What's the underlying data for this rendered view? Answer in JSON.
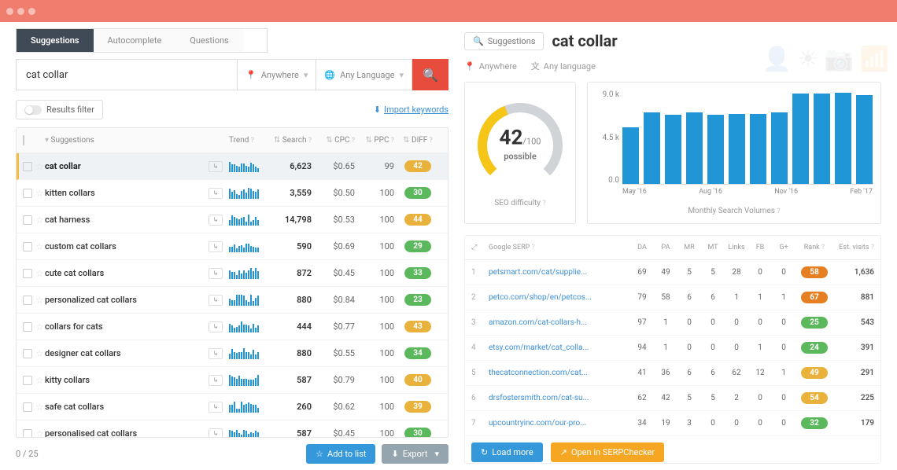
{
  "tabs": {
    "t0": "Suggestions",
    "t1": "Autocomplete",
    "t2": "Questions"
  },
  "query": "cat collar",
  "where_label": "Anywhere",
  "lang_label": "Any Language",
  "filter_label": "Results filter",
  "import_label": "Import keywords",
  "th": {
    "sug": "Suggestions",
    "trend": "Trend",
    "search": "Search",
    "cpc": "CPC",
    "ppc": "PPC",
    "diff": "DIFF"
  },
  "rows": [
    {
      "kw": "cat collar",
      "search": "6,623",
      "cpc": "$0.65",
      "ppc": "99",
      "diff": "42",
      "cls": "y",
      "active": true
    },
    {
      "kw": "kitten collars",
      "search": "3,559",
      "cpc": "$0.50",
      "ppc": "100",
      "diff": "30",
      "cls": "g"
    },
    {
      "kw": "cat harness",
      "search": "14,798",
      "cpc": "$0.53",
      "ppc": "100",
      "diff": "44",
      "cls": "y"
    },
    {
      "kw": "custom cat collars",
      "search": "590",
      "cpc": "$0.69",
      "ppc": "100",
      "diff": "29",
      "cls": "g"
    },
    {
      "kw": "cute cat collars",
      "search": "872",
      "cpc": "$0.45",
      "ppc": "100",
      "diff": "33",
      "cls": "g"
    },
    {
      "kw": "personalized cat collars",
      "search": "880",
      "cpc": "$0.84",
      "ppc": "100",
      "diff": "23",
      "cls": "g"
    },
    {
      "kw": "collars for cats",
      "search": "444",
      "cpc": "$0.77",
      "ppc": "100",
      "diff": "43",
      "cls": "y"
    },
    {
      "kw": "designer cat collars",
      "search": "880",
      "cpc": "$0.55",
      "ppc": "100",
      "diff": "34",
      "cls": "g"
    },
    {
      "kw": "kitty collars",
      "search": "587",
      "cpc": "$0.79",
      "ppc": "100",
      "diff": "40",
      "cls": "y"
    },
    {
      "kw": "safe cat collars",
      "search": "260",
      "cpc": "$0.62",
      "ppc": "100",
      "diff": "39",
      "cls": "y"
    },
    {
      "kw": "personalised cat collars",
      "search": "587",
      "cpc": "$0.45",
      "ppc": "100",
      "diff": "30",
      "cls": "g"
    }
  ],
  "pager": "0 / 25",
  "add_label": "Add to list",
  "export_label": "Export",
  "bc_btn": "Suggestions",
  "bc_title": "cat collar",
  "loc_where": "Anywhere",
  "loc_lang": "Any language",
  "gauge": {
    "n": "42",
    "d": "/100",
    "lbl": "possible"
  },
  "seo_label": "SEO difficulty",
  "vol_label": "Monthly Search Volumes",
  "chart_data": {
    "type": "bar",
    "ylabels": [
      "9.0 k",
      "4.5 k",
      "0.0"
    ],
    "xlabels": [
      "May '16",
      "Aug '16",
      "Nov '16",
      "Feb '17"
    ],
    "ylim": [
      0,
      9000
    ],
    "values": [
      5400,
      6800,
      6600,
      6800,
      6600,
      6700,
      6700,
      6800,
      8600,
      8600,
      8700,
      8500
    ]
  },
  "serp_th": {
    "url": "Google SERP",
    "da": "DA",
    "pa": "PA",
    "mr": "MR",
    "mt": "MT",
    "links": "Links",
    "fb": "FB",
    "gp": "G+",
    "rank": "Rank",
    "ev": "Est. visits"
  },
  "serp": [
    {
      "n": "1",
      "url": "petsmart.com/cat/supplie...",
      "da": "69",
      "pa": "49",
      "mr": "5",
      "mt": "5",
      "links": "28",
      "fb": "0",
      "gp": "0",
      "rank": "58",
      "cls": "o",
      "ev": "1,636"
    },
    {
      "n": "2",
      "url": "petco.com/shop/en/petcos...",
      "da": "79",
      "pa": "58",
      "mr": "6",
      "mt": "6",
      "links": "1",
      "fb": "1",
      "gp": "1",
      "rank": "67",
      "cls": "o",
      "ev": "881"
    },
    {
      "n": "3",
      "url": "amazon.com/cat-collars-h...",
      "da": "97",
      "pa": "1",
      "mr": "0",
      "mt": "0",
      "links": "0",
      "fb": "0",
      "gp": "0",
      "rank": "25",
      "cls": "g",
      "ev": "543"
    },
    {
      "n": "4",
      "url": "etsy.com/market/cat_colla...",
      "da": "94",
      "pa": "1",
      "mr": "0",
      "mt": "0",
      "links": "0",
      "fb": "1",
      "gp": "0",
      "rank": "24",
      "cls": "g",
      "ev": "391"
    },
    {
      "n": "5",
      "url": "thecatconnection.com/cat...",
      "da": "41",
      "pa": "36",
      "mr": "6",
      "mt": "6",
      "links": "62",
      "fb": "12",
      "gp": "1",
      "rank": "49",
      "cls": "y",
      "ev": "291"
    },
    {
      "n": "6",
      "url": "drsfostersmith.com/cat-su...",
      "da": "62",
      "pa": "42",
      "mr": "5",
      "mt": "5",
      "links": "2",
      "fb": "0",
      "gp": "0",
      "rank": "54",
      "cls": "y",
      "ev": "225"
    },
    {
      "n": "7",
      "url": "upcountryinc.com/our-pro...",
      "da": "34",
      "pa": "19",
      "mr": "3",
      "mt": "0",
      "links": "0",
      "fb": "0",
      "gp": "0",
      "rank": "32",
      "cls": "g",
      "ev": "179"
    }
  ],
  "load_more": "Load more",
  "open_serp": "Open in SERPChecker",
  "pill_colors": {
    "g": "#5cb85c",
    "y": "#e8b23c",
    "o": "#e67e22"
  }
}
